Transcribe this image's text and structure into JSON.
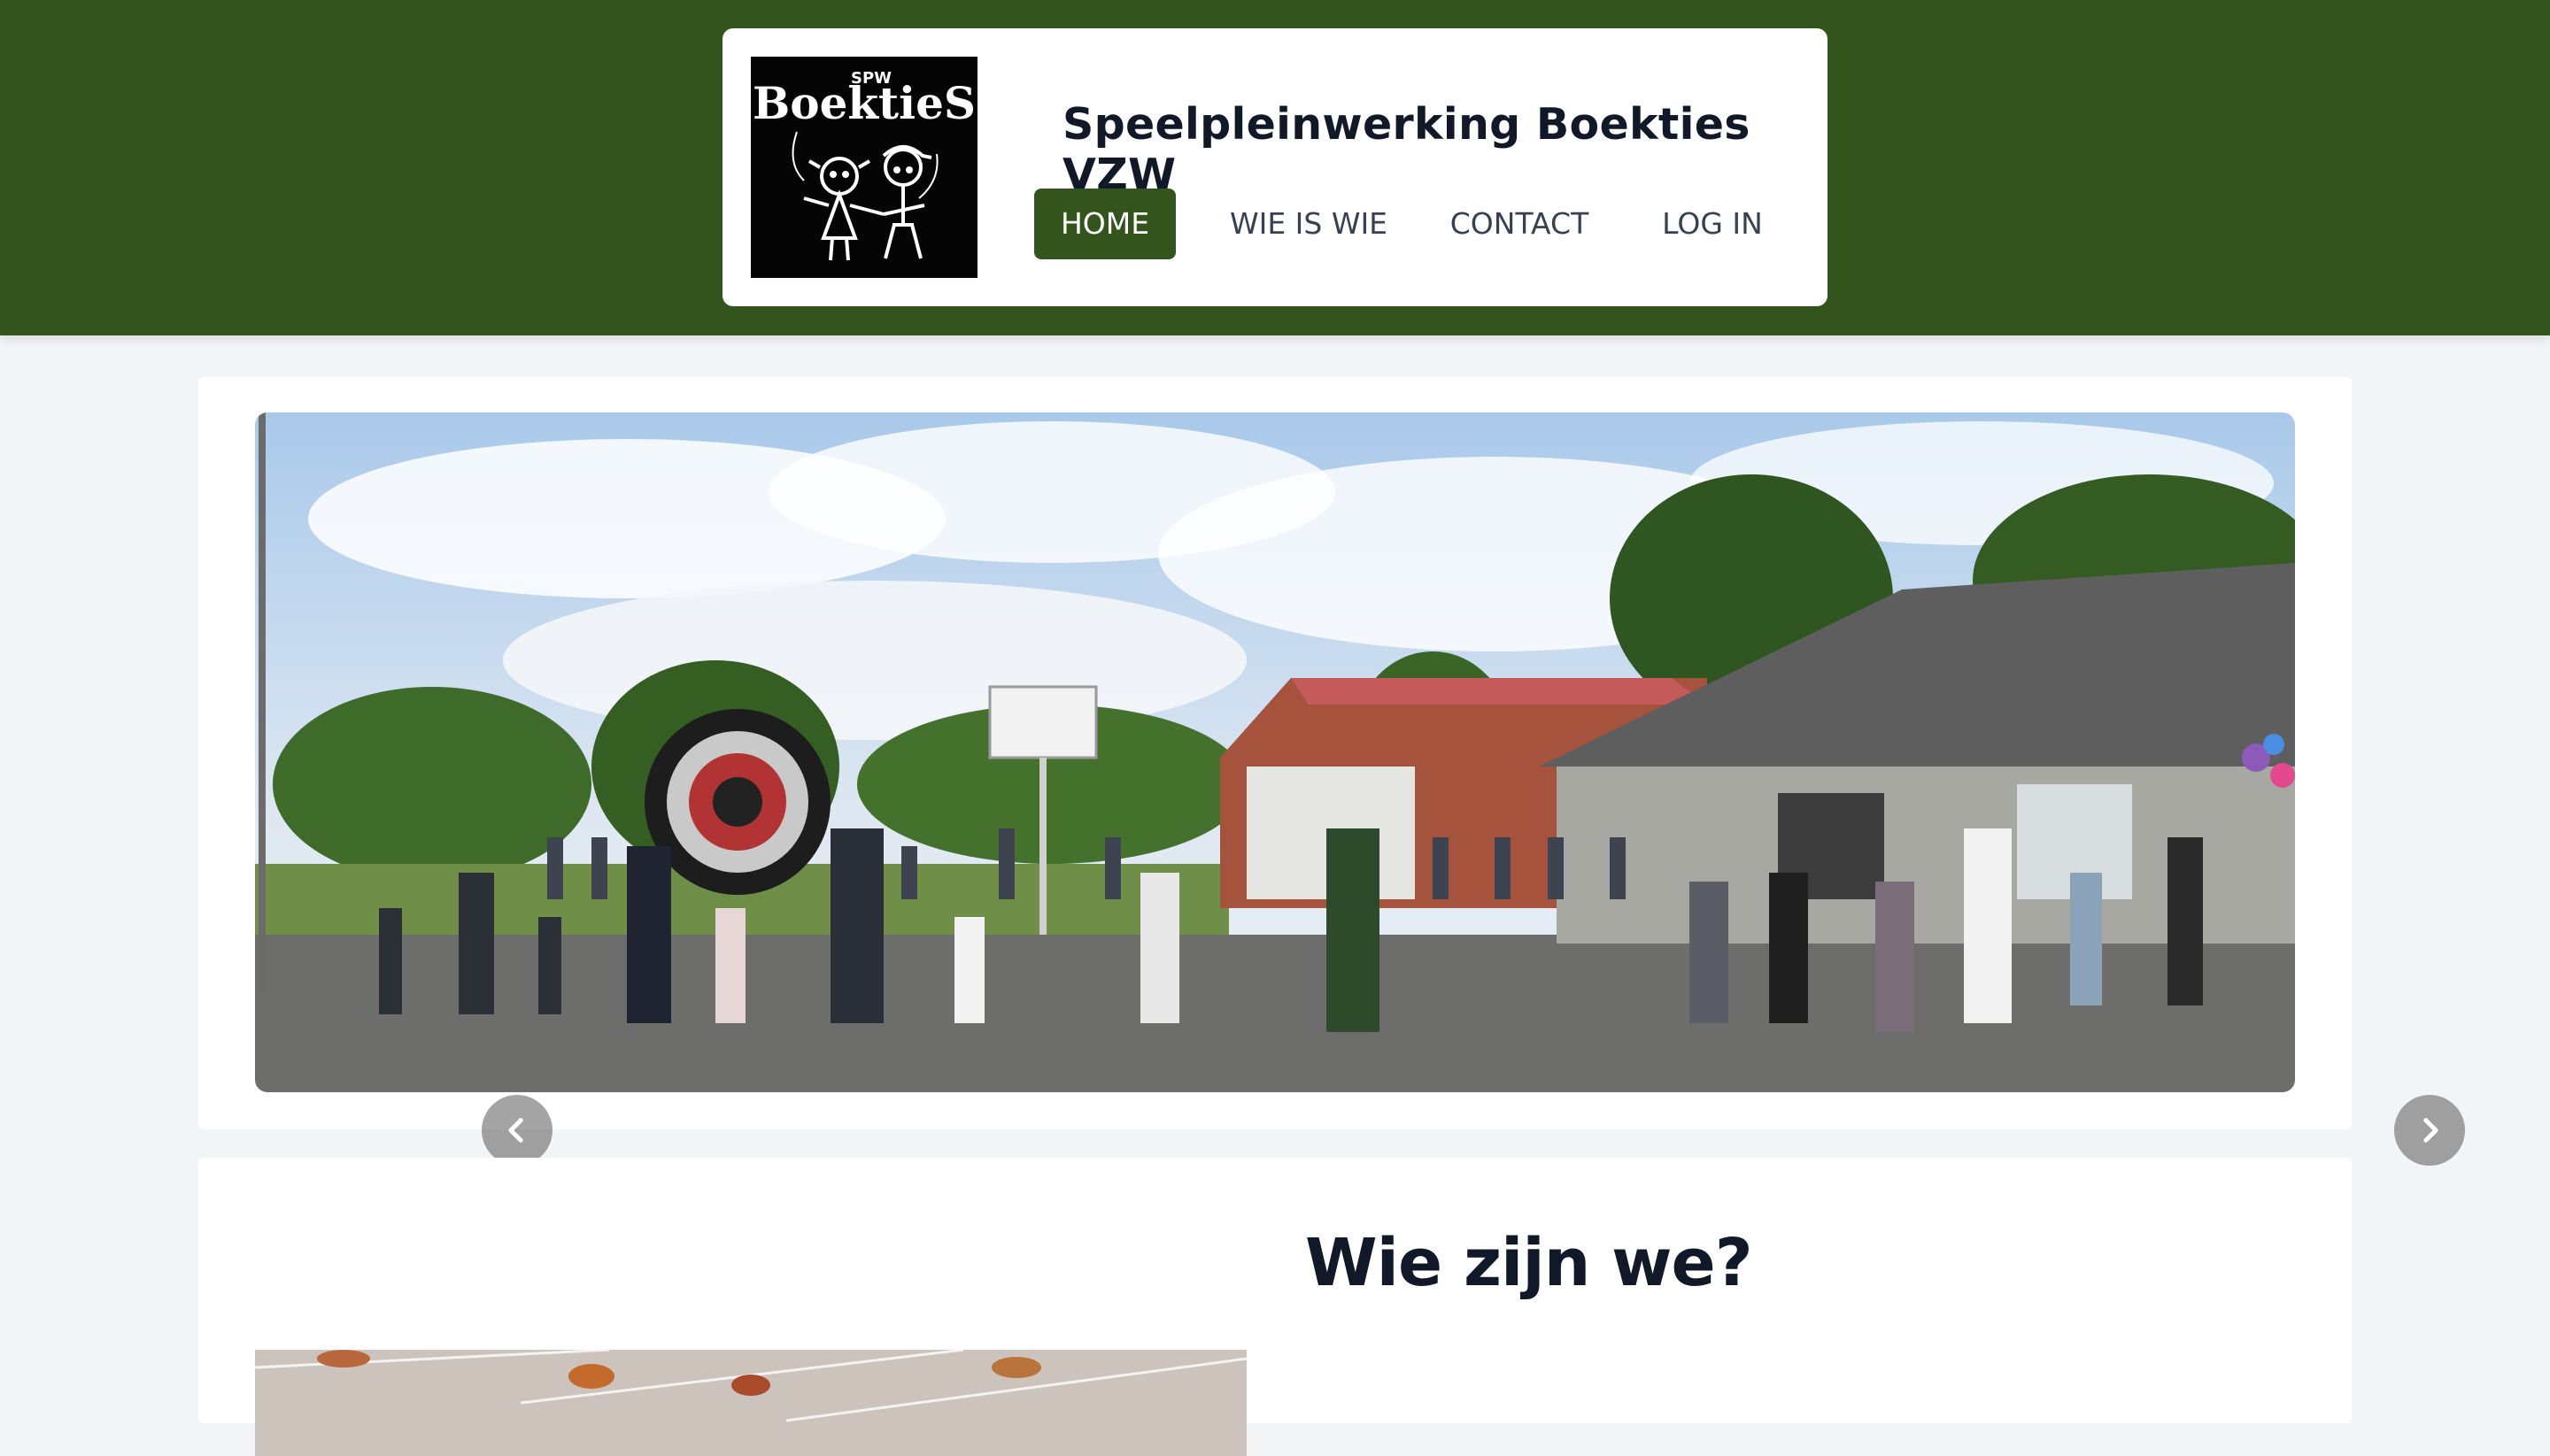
{
  "header": {
    "logo": {
      "small_text": "SPW",
      "brand_text": "BoektieS"
    },
    "title": "Speelpleinwerking Boekties VZW",
    "nav": [
      {
        "label": "HOME",
        "active": true
      },
      {
        "label": "WIE IS WIE",
        "active": false
      },
      {
        "label": "CONTACT",
        "active": false
      },
      {
        "label": "LOG IN",
        "active": false
      }
    ]
  },
  "slider": {
    "prev_icon": "chevron-left-icon",
    "next_icon": "chevron-right-icon"
  },
  "about": {
    "title": "Wie zijn we?"
  },
  "colors": {
    "brand_green": "#33541c",
    "page_bg": "#f3f4f6",
    "text_dark": "#111827"
  }
}
